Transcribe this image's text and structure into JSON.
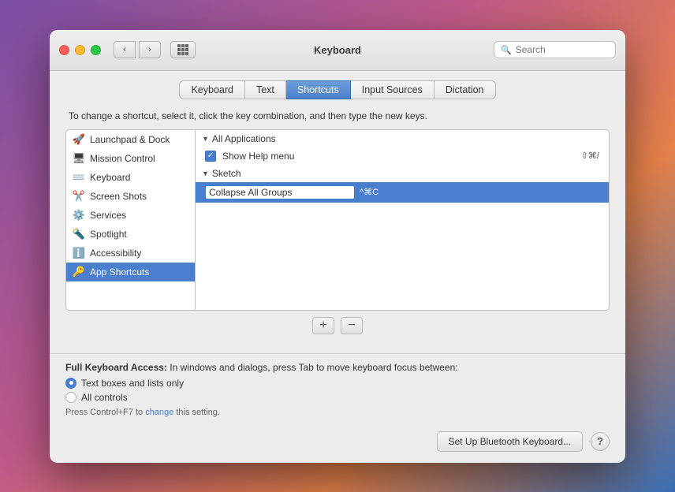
{
  "window": {
    "title": "Keyboard",
    "traffic_lights": [
      "close",
      "minimize",
      "maximize"
    ]
  },
  "search": {
    "placeholder": "Search"
  },
  "tabs": [
    {
      "id": "keyboard",
      "label": "Keyboard",
      "active": false
    },
    {
      "id": "text",
      "label": "Text",
      "active": false
    },
    {
      "id": "shortcuts",
      "label": "Shortcuts",
      "active": true
    },
    {
      "id": "input-sources",
      "label": "Input Sources",
      "active": false
    },
    {
      "id": "dictation",
      "label": "Dictation",
      "active": false
    }
  ],
  "description": "To change a shortcut, select it, click the key combination, and then type the new keys.",
  "sidebar": {
    "items": [
      {
        "id": "launchpad",
        "label": "Launchpad & Dock",
        "icon": "🚀"
      },
      {
        "id": "mission-control",
        "label": "Mission Control",
        "icon": "🖥"
      },
      {
        "id": "keyboard",
        "label": "Keyboard",
        "icon": "⌨️"
      },
      {
        "id": "screenshots",
        "label": "Screen Shots",
        "icon": "✂️"
      },
      {
        "id": "services",
        "label": "Services",
        "icon": "⚙️"
      },
      {
        "id": "spotlight",
        "label": "Spotlight",
        "icon": "ℹ️"
      },
      {
        "id": "accessibility",
        "label": "Accessibility",
        "icon": "ℹ️"
      },
      {
        "id": "app-shortcuts",
        "label": "App Shortcuts",
        "icon": "🔑",
        "selected": true
      }
    ]
  },
  "shortcut_panel": {
    "sections": [
      {
        "id": "all-applications",
        "label": "All Applications",
        "expanded": true,
        "items": [
          {
            "id": "show-help",
            "label": "Show Help menu",
            "keys": "⇧⌘/",
            "checked": true,
            "editing": false
          }
        ]
      },
      {
        "id": "sketch",
        "label": "Sketch",
        "expanded": true,
        "items": [
          {
            "id": "collapse-groups",
            "label": "Collapse All Groups",
            "keys": "^⌘C",
            "checked": false,
            "editing": true,
            "selected": true
          }
        ]
      }
    ]
  },
  "bottom_buttons": {
    "add_label": "+",
    "remove_label": "−"
  },
  "keyboard_access": {
    "label": "Full Keyboard Access:",
    "description": "In windows and dialogs, press Tab to move keyboard focus between:",
    "options": [
      {
        "id": "text-boxes",
        "label": "Text boxes and lists only",
        "checked": true
      },
      {
        "id": "all-controls",
        "label": "All controls",
        "checked": false
      }
    ],
    "hint": "Press Control+F7 to change this setting."
  },
  "footer": {
    "bluetooth_button": "Set Up Bluetooth Keyboard...",
    "help_label": "?"
  }
}
